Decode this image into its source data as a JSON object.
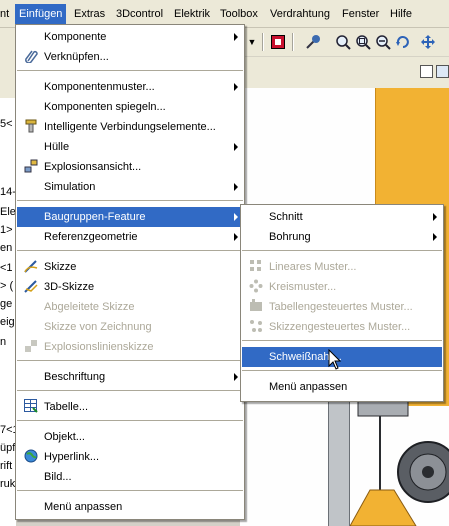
{
  "menubar": {
    "items": [
      {
        "label": "nt"
      },
      {
        "label": "Einfügen"
      },
      {
        "label": "Extras"
      },
      {
        "label": "3Dcontrol"
      },
      {
        "label": "Elektrik"
      },
      {
        "label": "Toolbox"
      },
      {
        "label": "Verdrahtung"
      },
      {
        "label": "Fenster"
      },
      {
        "label": "Hilfe"
      }
    ]
  },
  "toolbar": {
    "icons": [
      "dropdown-arrow-icon",
      "stop-icon",
      "pin-icon",
      "zoom-fit-icon",
      "zoom-window-icon",
      "zoom-in-out-icon",
      "rotate-icon",
      "pan-icon"
    ]
  },
  "left_pane": {
    "fragments": [
      "5<",
      "14-",
      "Ele",
      "1>",
      "en",
      "<1",
      "> (",
      "ge",
      "eig",
      "n",
      "7<1",
      "üpf",
      "rift",
      "ruk"
    ]
  },
  "insert_menu": {
    "items": [
      {
        "label": "Komponente",
        "submenu": true
      },
      {
        "label": "Verknüpfen...",
        "icon": "paperclip-icon"
      },
      {
        "label": "Komponentenmuster...",
        "submenu": true
      },
      {
        "label": "Komponenten spiegeln..."
      },
      {
        "label": "Intelligente Verbindungselemente...",
        "icon": "fastener-icon"
      },
      {
        "label": "Hülle",
        "submenu": true
      },
      {
        "label": "Explosionsansicht...",
        "icon": "explode-icon"
      },
      {
        "label": "Simulation",
        "submenu": true
      },
      {
        "label": "Baugruppen-Feature",
        "submenu": true,
        "highlighted": true
      },
      {
        "label": "Referenzgeometrie",
        "submenu": true
      },
      {
        "label": "Skizze",
        "icon": "sketch-icon"
      },
      {
        "label": "3D-Skizze",
        "icon": "sketch-3d-icon"
      },
      {
        "label": "Abgeleitete Skizze",
        "disabled": true
      },
      {
        "label": "Skizze von Zeichnung",
        "disabled": true
      },
      {
        "label": "Explosionslinienskizze",
        "disabled": true,
        "icon": "explode-line-icon"
      },
      {
        "label": "Beschriftung",
        "submenu": true
      },
      {
        "label": "Tabelle...",
        "icon": "table-icon"
      },
      {
        "label": "Objekt..."
      },
      {
        "label": "Hyperlink...",
        "icon": "globe-icon"
      },
      {
        "label": "Bild..."
      },
      {
        "label": "Menü anpassen"
      }
    ]
  },
  "feature_submenu": {
    "items": [
      {
        "label": "Schnitt",
        "submenu": true
      },
      {
        "label": "Bohrung",
        "submenu": true
      },
      {
        "label": "Lineares Muster...",
        "disabled": true,
        "icon": "linear-pattern-icon"
      },
      {
        "label": "Kreismuster...",
        "disabled": true,
        "icon": "circular-pattern-icon"
      },
      {
        "label": "Tabellengesteuertes Muster...",
        "disabled": true,
        "icon": "table-pattern-icon"
      },
      {
        "label": "Skizzengesteuertes Muster...",
        "disabled": true,
        "icon": "sketch-pattern-icon"
      },
      {
        "label": "Schweißnaht...",
        "highlighted": true
      },
      {
        "label": "Menü anpassen"
      }
    ]
  },
  "colors": {
    "highlight": "#316ac5",
    "menubar": "#ece9d8",
    "disabled_text": "#aca899",
    "pipe": "#f2b233"
  }
}
